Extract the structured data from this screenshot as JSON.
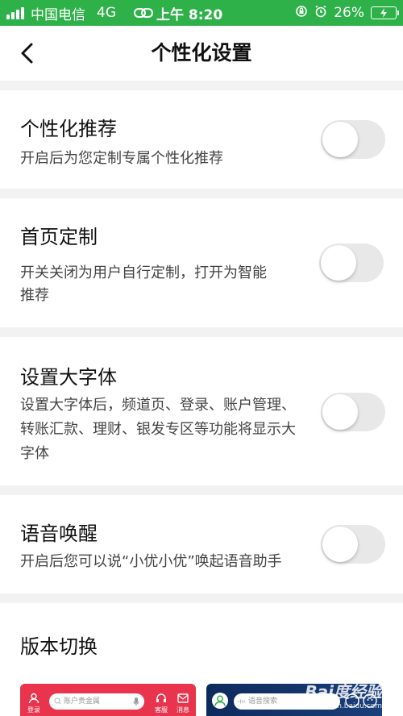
{
  "status_bar": {
    "carrier": "中国电信",
    "network": "4G",
    "time": "上午 8:20",
    "battery": "26%",
    "signal_bars": 4
  },
  "nav": {
    "title": "个性化设置",
    "back_icon": "chevron-left-icon"
  },
  "settings": [
    {
      "title": "个性化推荐",
      "desc_lines": [
        "开启后为您定制专属个性化推荐"
      ],
      "enabled": false
    },
    {
      "title": "首页定制",
      "desc_lines": [
        "开关关闭为用户自行定制，打开为智能",
        "推荐"
      ],
      "enabled": false
    },
    {
      "title": "设置大字体",
      "desc_lines": [
        "设置大字体后，频道页、登录、账户管理、",
        "转账汇款、理财、银发专区等功能将显示大",
        "字体"
      ],
      "enabled": false
    },
    {
      "title": "语音唤醒",
      "desc_lines": [
        "开启后您可以说“小优小优”唤起语音助手"
      ],
      "enabled": false
    }
  ],
  "version": {
    "title": "版本切换",
    "standard": {
      "login_label": "登录",
      "search_placeholder": "账户贵金属",
      "service_label": "客服",
      "message_label": "消息"
    },
    "dark": {
      "search_placeholder": "语音搜索"
    }
  },
  "watermark": {
    "brand": "Bai度经验",
    "url": "jingyan.baidu.com"
  },
  "colors": {
    "status_bar": "#2fb14a",
    "toggle_off": "#e8e8e8",
    "version_red": "#e8354d",
    "version_dark": "#0d2a5c"
  }
}
